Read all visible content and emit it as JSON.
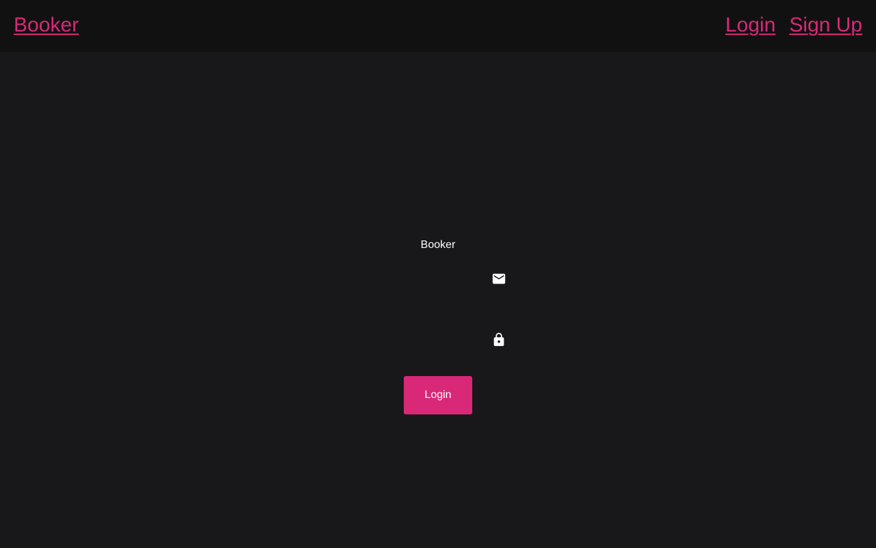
{
  "header": {
    "brand": "Booker",
    "nav": {
      "login": "Login",
      "signup": "Sign Up"
    }
  },
  "form": {
    "title": "Booker",
    "email": {
      "value": "",
      "icon": "mail-icon"
    },
    "password": {
      "value": "",
      "icon": "lock-icon"
    },
    "submit_label": "Login"
  },
  "colors": {
    "accent": "#d92877",
    "background": "#18181a",
    "header_background": "#111112",
    "text": "#ffffff"
  }
}
